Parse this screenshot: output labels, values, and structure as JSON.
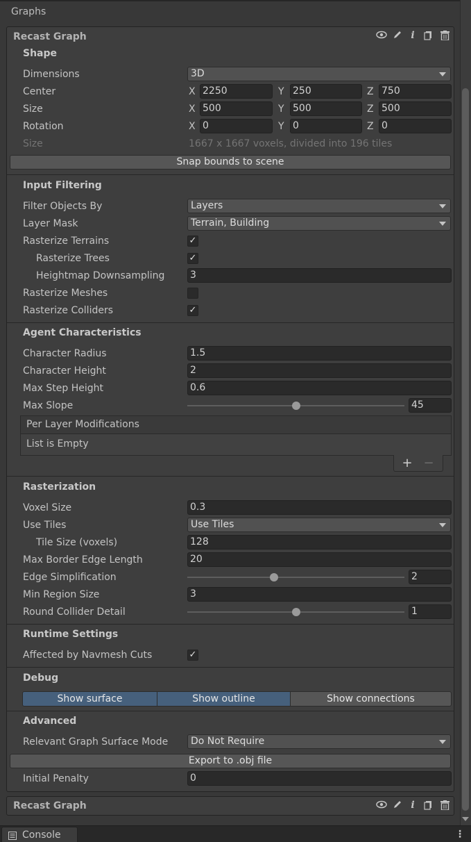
{
  "header": {
    "title": "Graphs"
  },
  "panel": {
    "title": "Recast Graph",
    "icons": [
      "eye-icon",
      "pencil-icon",
      "info-icon",
      "copy-icon",
      "trash-icon"
    ]
  },
  "shape": {
    "title": "Shape",
    "dimensions": {
      "label": "Dimensions",
      "value": "3D"
    },
    "center": {
      "label": "Center",
      "x_label": "X",
      "y_label": "Y",
      "z_label": "Z",
      "x": "2250",
      "y": "250",
      "z": "750"
    },
    "size": {
      "label": "Size",
      "x_label": "X",
      "y_label": "Y",
      "z_label": "Z",
      "x": "500",
      "y": "500",
      "z": "500"
    },
    "rotation": {
      "label": "Rotation",
      "x_label": "X",
      "y_label": "Y",
      "z_label": "Z",
      "x": "0",
      "y": "0",
      "z": "0"
    },
    "size_info": {
      "label": "Size",
      "value": "1667 x 1667 voxels, divided into 196 tiles"
    },
    "snap_button": "Snap bounds to scene"
  },
  "input_filtering": {
    "title": "Input Filtering",
    "filter_by": {
      "label": "Filter Objects By",
      "value": "Layers"
    },
    "layer_mask": {
      "label": "Layer Mask",
      "value": "Terrain, Building"
    },
    "rasterize_terrains": {
      "label": "Rasterize Terrains",
      "checked": true
    },
    "rasterize_trees": {
      "label": "Rasterize Trees",
      "checked": true
    },
    "heightmap_downsampling": {
      "label": "Heightmap Downsampling",
      "value": "3"
    },
    "rasterize_meshes": {
      "label": "Rasterize Meshes",
      "checked": false
    },
    "rasterize_colliders": {
      "label": "Rasterize Colliders",
      "checked": true
    }
  },
  "agent": {
    "title": "Agent Characteristics",
    "radius": {
      "label": "Character Radius",
      "value": "1.5"
    },
    "height": {
      "label": "Character Height",
      "value": "2"
    },
    "max_step": {
      "label": "Max Step Height",
      "value": "0.6"
    },
    "max_slope": {
      "label": "Max Slope",
      "value": "45",
      "fraction": 0.5
    },
    "per_layer": {
      "title": "Per Layer Modifications",
      "empty": "List is Empty",
      "add": "+",
      "remove": "−"
    }
  },
  "rasterization": {
    "title": "Rasterization",
    "voxel_size": {
      "label": "Voxel Size",
      "value": "0.3"
    },
    "use_tiles": {
      "label": "Use Tiles",
      "value": "Use Tiles"
    },
    "tile_size": {
      "label": "Tile Size (voxels)",
      "value": "128"
    },
    "max_border": {
      "label": "Max Border Edge Length",
      "value": "20"
    },
    "edge_simplification": {
      "label": "Edge Simplification",
      "value": "2",
      "fraction": 0.4
    },
    "min_region": {
      "label": "Min Region Size",
      "value": "3"
    },
    "round_collider": {
      "label": "Round Collider Detail",
      "value": "1",
      "fraction": 0.5
    }
  },
  "runtime": {
    "title": "Runtime Settings",
    "navmesh_cuts": {
      "label": "Affected by Navmesh Cuts",
      "checked": true
    }
  },
  "debug": {
    "title": "Debug",
    "show_surface": "Show surface",
    "show_outline": "Show outline",
    "show_connections": "Show connections"
  },
  "advanced": {
    "title": "Advanced",
    "surface_mode": {
      "label": "Relevant Graph Surface Mode",
      "value": "Do Not Require"
    },
    "export_button": "Export to .obj file",
    "initial_penalty": {
      "label": "Initial Penalty",
      "value": "0"
    }
  },
  "panel2": {
    "title": "Recast Graph"
  },
  "statusbar": {
    "console_label": "Console",
    "menu": "⋮"
  },
  "colors": {
    "toggle_on": "#46607c",
    "background": "#383838",
    "panel": "#3e3e3e"
  }
}
